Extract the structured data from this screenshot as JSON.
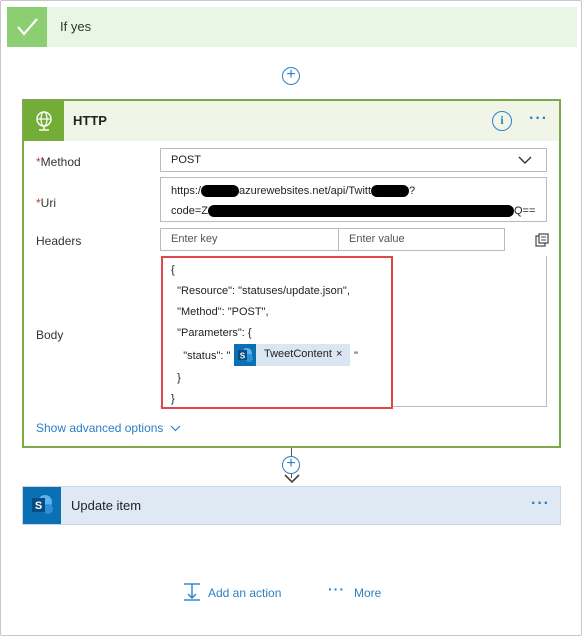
{
  "if_yes": {
    "title": "If yes"
  },
  "http": {
    "title": "HTTP",
    "method_label": "Method",
    "method_value": "POST",
    "uri_label": "Uri",
    "uri_line1_a": "https:/",
    "uri_line1_b": "azurewebsites.net/api/Twitt",
    "uri_line1_c": "?",
    "uri_line2_a": "code=Z",
    "uri_line2_b": "Q==",
    "headers_label": "Headers",
    "key_placeholder": "Enter key",
    "value_placeholder": "Enter value",
    "body_label": "Body",
    "body_lines": [
      "{",
      "  \"Resource\": \"statuses/update.json\",",
      "  \"Method\": \"POST\",",
      "  \"Parameters\": {",
      "    \"status\": \"",
      "  }",
      "}"
    ],
    "token_label": "TweetContent",
    "token_close": "×",
    "after_token": "\"",
    "show_advanced": "Show advanced options",
    "required_mark": "*"
  },
  "update_item": {
    "title": "Update item"
  },
  "footer": {
    "add_action": "Add an action",
    "more": "More"
  },
  "colors": {
    "accent": "#2d7fc7",
    "http_green": "#73ad37",
    "success_green": "#8ccf73",
    "sharepoint_blue": "#0b6fb4",
    "highlight_red": "#e0474c"
  }
}
